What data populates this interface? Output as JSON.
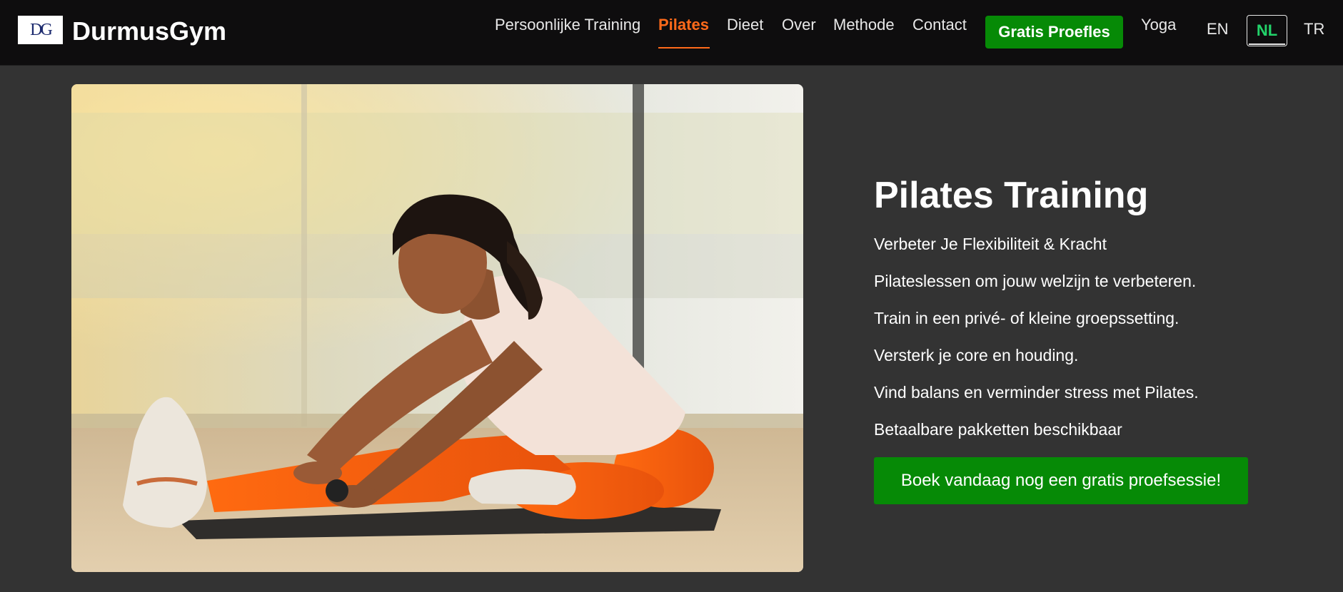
{
  "brand": {
    "logo_text": "DG",
    "name": "DurmusGym"
  },
  "nav": {
    "items": [
      {
        "label": "Persoonlijke Training"
      },
      {
        "label": "Pilates",
        "active": true
      },
      {
        "label": "Dieet"
      },
      {
        "label": "Over"
      },
      {
        "label": "Methode"
      },
      {
        "label": "Contact"
      }
    ],
    "cta_label": "Gratis Proefles",
    "extra_label": "Yoga",
    "languages": [
      "EN",
      "NL",
      "TR"
    ],
    "selected_language": "NL"
  },
  "hero": {
    "image_alt": "Vrouw doet een stretchoefening op een mat",
    "title": "Pilates Training",
    "lines": [
      "Verbeter Je Flexibiliteit & Kracht",
      "Pilateslessen om jouw welzijn te verbeteren.",
      "Train in een privé- of kleine groepssetting.",
      "Versterk je core en houding.",
      "Vind balans en verminder stress met Pilates.",
      "Betaalbare pakketten beschikbaar"
    ],
    "cta_label": "Boek vandaag nog een gratis proefsessie!"
  },
  "colors": {
    "nav_bg": "#0e0d0e",
    "page_bg": "#333333",
    "accent_orange": "#ff6a1a",
    "cta_green": "#068a06",
    "lang_active": "#22d36a"
  }
}
